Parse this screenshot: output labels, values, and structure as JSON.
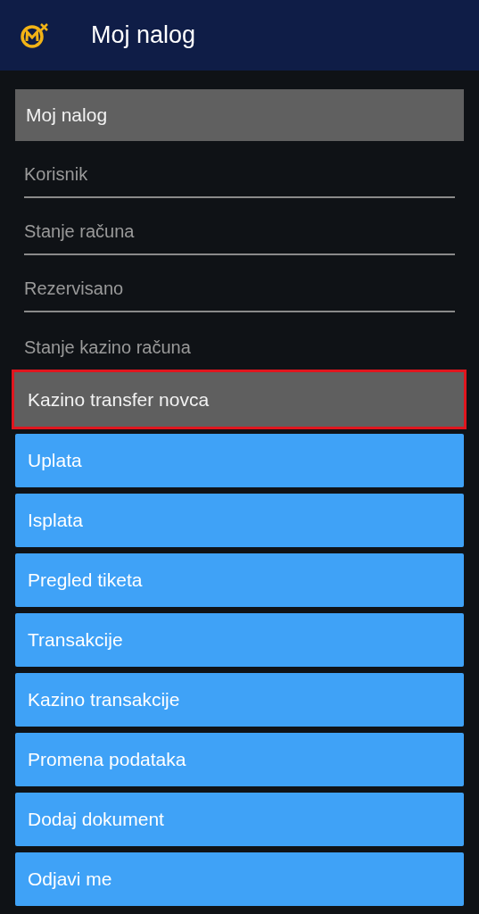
{
  "header": {
    "title": "Moj nalog"
  },
  "section": {
    "title": "Moj nalog"
  },
  "info_rows": [
    {
      "label": "Korisnik"
    },
    {
      "label": "Stanje računa"
    },
    {
      "label": "Rezervisano"
    },
    {
      "label": "Stanje kazino računa"
    }
  ],
  "transfer_button": {
    "label": "Kazino transfer novca",
    "highlighted": true
  },
  "menu": [
    {
      "label": "Uplata"
    },
    {
      "label": "Isplata"
    },
    {
      "label": "Pregled tiketa"
    },
    {
      "label": "Transakcije"
    },
    {
      "label": "Kazino transakcije"
    },
    {
      "label": "Promena podataka"
    },
    {
      "label": "Dodaj dokument"
    },
    {
      "label": "Odjavi me"
    }
  ]
}
